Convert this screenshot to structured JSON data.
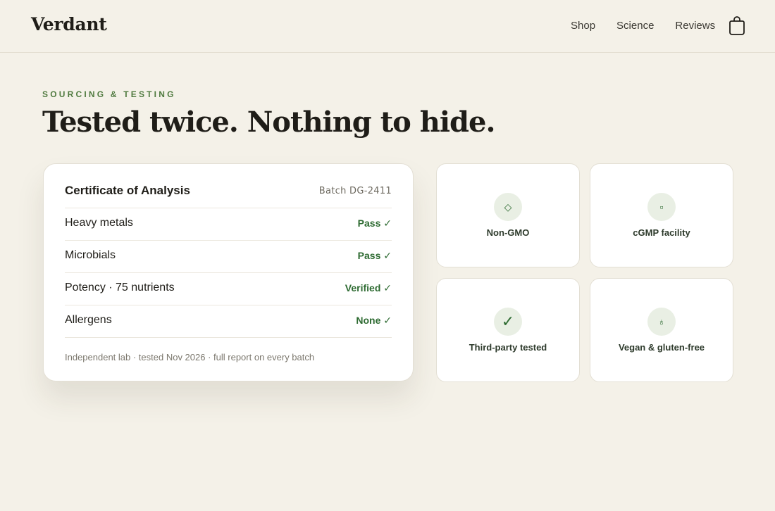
{
  "brand": "Verdant",
  "nav": {
    "items": [
      "Shop",
      "Science",
      "Reviews"
    ],
    "cart_icon": "shopping-bag-icon"
  },
  "hero": {
    "eyebrow": "SOURCING & TESTING",
    "headline": "Tested twice. Nothing to hide."
  },
  "certificate": {
    "title": "Certificate of Analysis",
    "batch": "Batch DG-2411",
    "rows": [
      {
        "label": "Heavy metals",
        "result": "Pass ✓"
      },
      {
        "label": "Microbials",
        "result": "Pass ✓"
      },
      {
        "label": "Potency · 75 nutrients",
        "result": "Verified ✓"
      },
      {
        "label": "Allergens",
        "result": "None ✓"
      }
    ],
    "footnote": "Independent lab · tested Nov 2026 · full report on every batch"
  },
  "badges": [
    {
      "icon": "diamond-icon",
      "glyph": "◇",
      "label": "Non-GMO"
    },
    {
      "icon": "square-icon",
      "glyph": "▫",
      "label": "cGMP facility"
    },
    {
      "icon": "checkmark-icon",
      "glyph": "✓",
      "label": "Third-party tested"
    },
    {
      "icon": "leaf-drop-icon",
      "glyph": "♁",
      "label": "Vegan & gluten-free"
    }
  ],
  "colors": {
    "background": "#f4f1e8",
    "accent_green": "#2e6b32",
    "eyebrow_green": "#4f7a3f",
    "icon_circle": "#e9efe4"
  }
}
